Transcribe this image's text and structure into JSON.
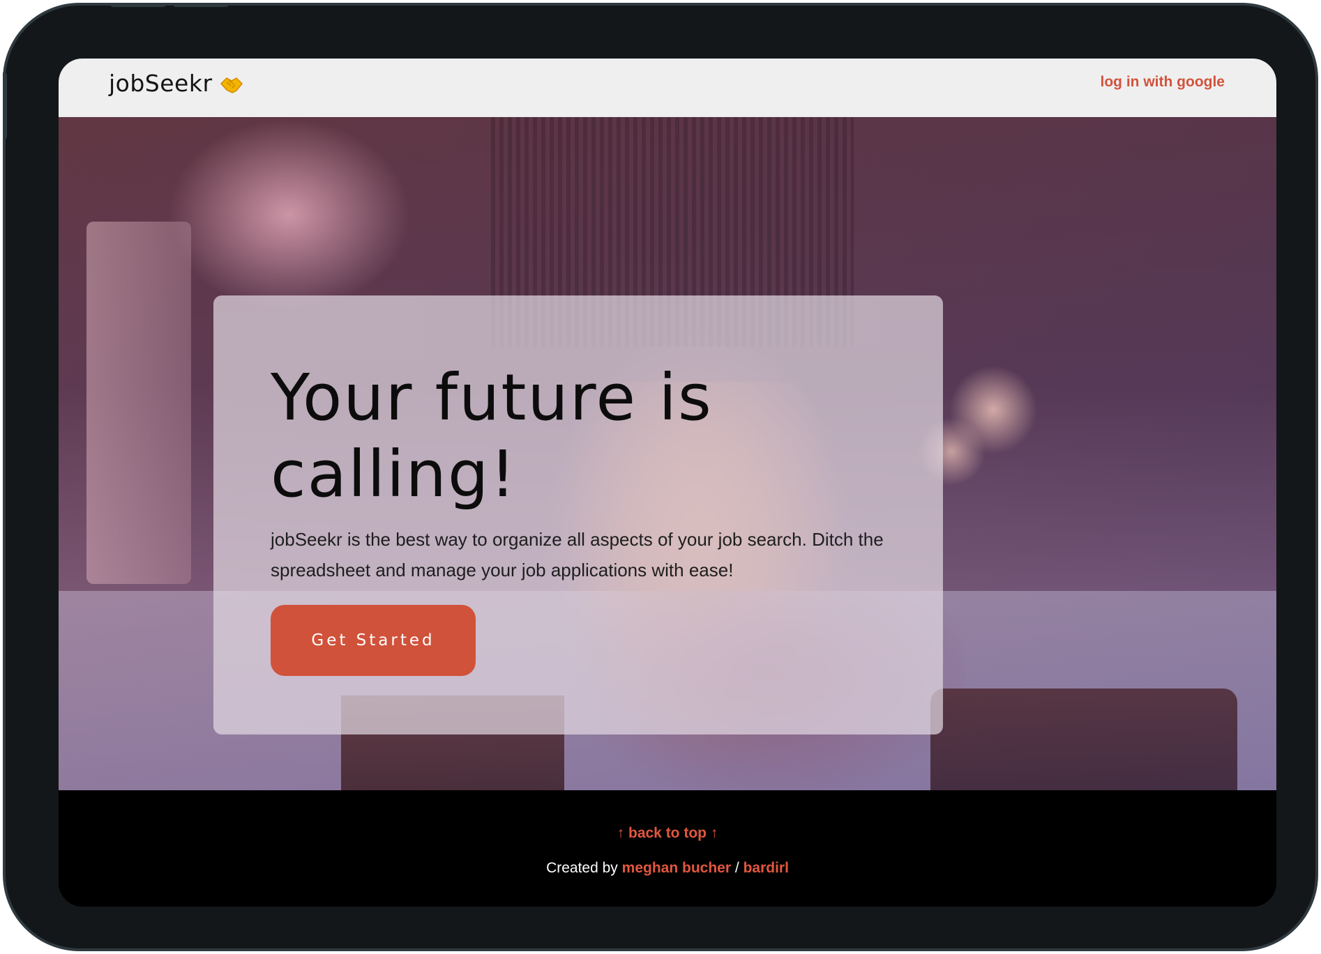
{
  "navbar": {
    "brand": "jobSeekr",
    "brand_icon": "handshake-emoji",
    "login_label": "log in with google"
  },
  "hero": {
    "headline": "Your future is calling!",
    "description": "jobSeekr is the best way to organize all aspects of your job search. Ditch the spreadsheet and manage your job applications with ease!",
    "cta_label": "Get Started"
  },
  "footer": {
    "back_to_top": "↑ back to top ↑",
    "created_by": "Created by",
    "author": "meghan bucher",
    "separator": "/",
    "handle": "bardirl"
  },
  "colors": {
    "accent": "#d0523a",
    "navbar_bg": "#f0eff0",
    "footer_bg": "#000000",
    "device_frame": "#131719"
  }
}
